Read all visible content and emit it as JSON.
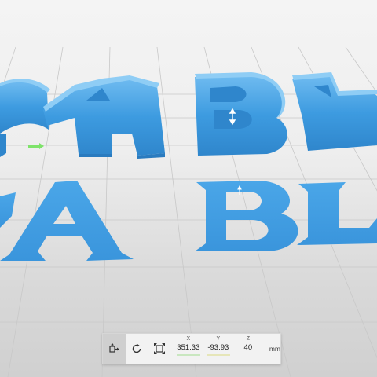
{
  "viewport": {
    "scene_description_color": "#3d9be0",
    "wall_color": "#3a94d8",
    "grid_color": "#c7c7c7"
  },
  "toolbar": {
    "tools": [
      {
        "name": "move-tool",
        "icon": "move-icon",
        "active": true
      },
      {
        "name": "rotate-tool",
        "icon": "rotate-icon",
        "active": false
      },
      {
        "name": "scale-tool",
        "icon": "scale-icon",
        "active": false
      }
    ],
    "x_label": "X",
    "x_value": "351.33",
    "y_label": "Y",
    "y_value": "-93.93",
    "z_label": "Z",
    "z_value": "40",
    "unit": "mm"
  }
}
